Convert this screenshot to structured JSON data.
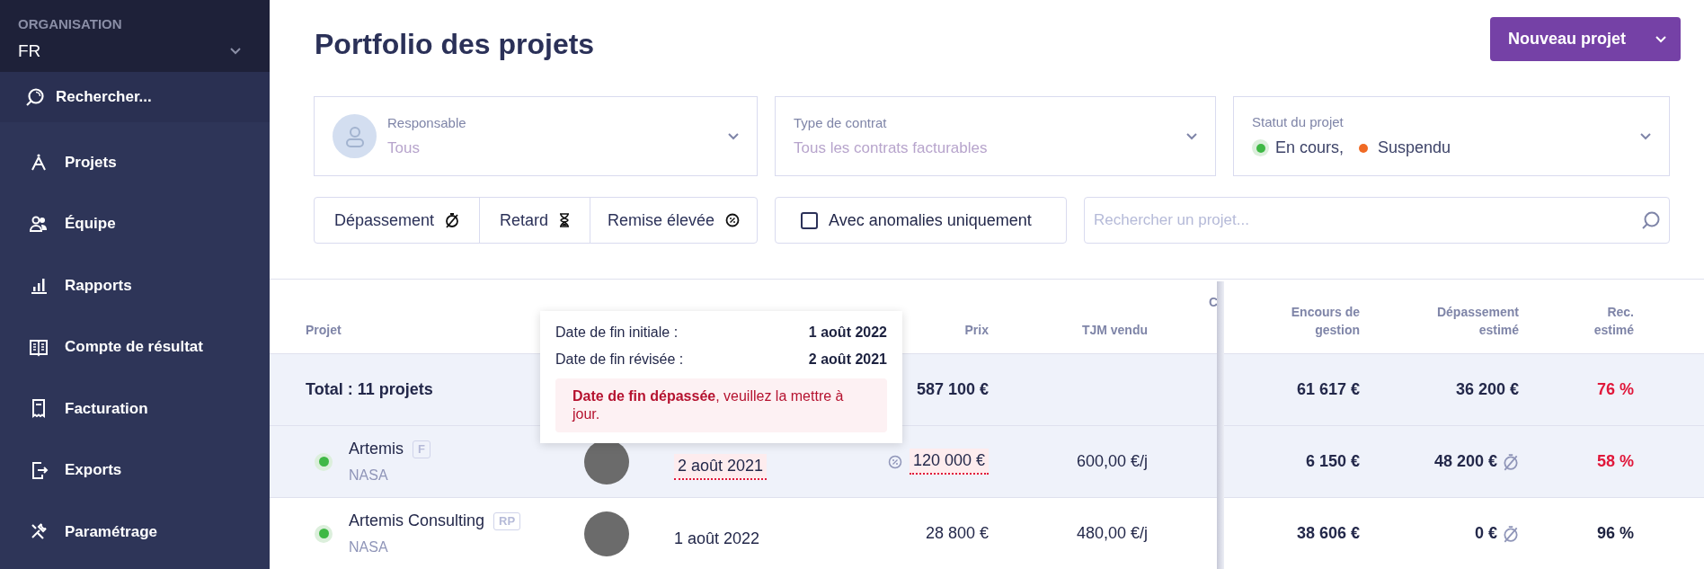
{
  "sidebar": {
    "org_label": "ORGANISATION",
    "org_value": "FR",
    "search": "Rechercher...",
    "items": [
      {
        "label": "Projets",
        "kind": "compass"
      },
      {
        "label": "Équipe",
        "kind": "team"
      },
      {
        "label": "Rapports",
        "kind": "chart"
      },
      {
        "label": "Compte de résultat",
        "kind": "book"
      },
      {
        "label": "Facturation",
        "kind": "receipt"
      },
      {
        "label": "Exports",
        "kind": "export"
      },
      {
        "label": "Paramétrage",
        "kind": "tools"
      }
    ]
  },
  "header": {
    "title": "Portfolio des projets",
    "new_button": "Nouveau projet"
  },
  "filters": {
    "owner": {
      "label": "Responsable",
      "value": "Tous"
    },
    "contract": {
      "label": "Type de contrat",
      "value": "Tous les contrats facturables"
    },
    "status": {
      "label": "Statut du projet",
      "values": [
        {
          "label": "En cours,",
          "color": "#3fb845"
        },
        {
          "label": "Suspendu",
          "color": "#f06a24"
        }
      ]
    },
    "toggles": [
      {
        "label": "Dépassement",
        "kind": "overrun"
      },
      {
        "label": "Retard",
        "kind": "delay"
      },
      {
        "label": "Remise élevée",
        "kind": "discount"
      }
    ],
    "anomalies": {
      "label": "Avec anomalies uniquement",
      "checked": false
    },
    "search": {
      "placeholder": "Rechercher un projet..."
    }
  },
  "table": {
    "columns": [
      "Projet",
      "Prix",
      "TJM vendu",
      "C",
      "Encours de gestion",
      "Dépassement estimé",
      "Rec. estimé"
    ],
    "total": {
      "label": "Total : 11 projets",
      "price": "587 100 €",
      "encours": "61 617 €",
      "overrun": "36 200 €",
      "rec": "76 %",
      "rec_alert": true
    },
    "rows": [
      {
        "name": "Artemis",
        "badge": "F",
        "client": "NASA",
        "color": "#3fb845",
        "end_date": "2 août 2021",
        "date_overdue": true,
        "discount": true,
        "price": "120 000 €",
        "price_flag": true,
        "tjm": "600,00 €/j",
        "encours": "6 150 €",
        "overrun": "48 200 €",
        "rec": "58 %",
        "rec_alert": true,
        "selected": true
      },
      {
        "name": "Artemis Consulting",
        "badge": "RP",
        "client": "NASA",
        "color": "#3fb845",
        "end_date": "1 août 2022",
        "date_overdue": false,
        "discount": false,
        "price": "28 800 €",
        "price_flag": false,
        "tjm": "480,00 €/j",
        "encours": "38 606 €",
        "overrun": "0 €",
        "rec": "96 %",
        "rec_alert": false,
        "selected": false
      }
    ]
  },
  "tooltip": {
    "rows": [
      {
        "label": "Date de fin initiale :",
        "value": "1 août 2022"
      },
      {
        "label": "Date de fin révisée :",
        "value": "2 août 2021"
      }
    ],
    "message": "**Date de fin dépassée**, veuillez la mettre à jour."
  }
}
